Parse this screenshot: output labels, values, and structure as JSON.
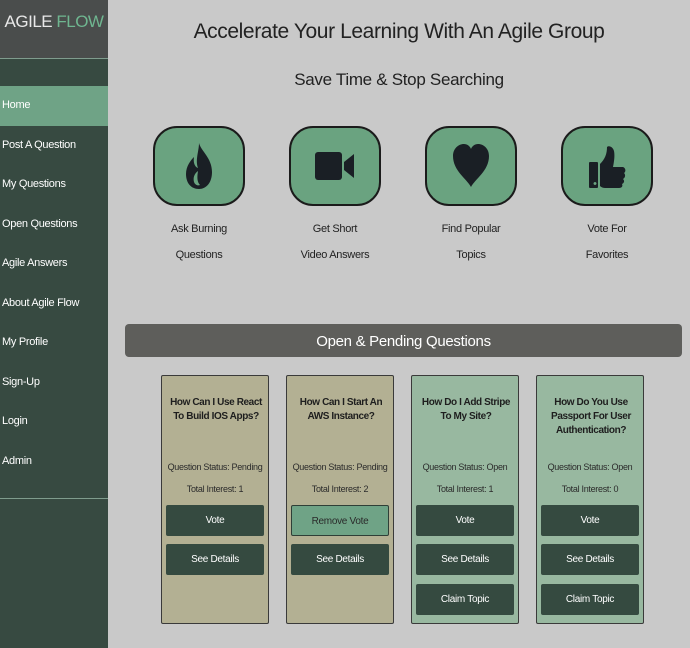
{
  "brand": {
    "part1": "AGILE",
    "part2": "FLOW"
  },
  "nav": {
    "items": [
      "Home",
      "Post A Question",
      "My Questions",
      "Open Questions",
      "Agile Answers",
      "About Agile Flow",
      "My Profile",
      "Sign-Up",
      "Login",
      "Admin"
    ],
    "active": "Home"
  },
  "hero": {
    "headline": "Accelerate Your Learning With An Agile Group",
    "subline": "Save Time & Stop Searching"
  },
  "features": [
    {
      "icon": "fire-icon",
      "line1": "Ask Burning",
      "line2": "Questions"
    },
    {
      "icon": "video-camera-icon",
      "line1": "Get Short",
      "line2": "Video Answers"
    },
    {
      "icon": "heart-icon",
      "line1": "Find Popular",
      "line2": "Topics"
    },
    {
      "icon": "thumbs-up-icon",
      "line1": "Vote For",
      "line2": "Favorites"
    }
  ],
  "section": {
    "title": "Open & Pending Questions"
  },
  "cards": [
    {
      "title": "How Can I Use React To Build IOS Apps?",
      "status": "Question Status: Pending",
      "interest": "Total Interest: 1",
      "vote_label": "Vote",
      "details_label": "See Details"
    },
    {
      "title": "How Can I Start An AWS Instance?",
      "status": "Question Status: Pending",
      "interest": "Total Interest: 2",
      "vote_label": "Remove Vote",
      "details_label": "See Details"
    },
    {
      "title": "How Do I Add Stripe To My Site?",
      "status": "Question Status: Open",
      "interest": "Total Interest: 1",
      "vote_label": "Vote",
      "details_label": "See Details",
      "claim_label": "Claim Topic"
    },
    {
      "title": "How Do You Use Passport For User Authentication?",
      "status": "Question Status: Open",
      "interest": "Total Interest: 0",
      "vote_label": "Vote",
      "details_label": "See Details",
      "claim_label": "Claim Topic"
    }
  ],
  "colors": {
    "sidebar": "#374a41",
    "accent": "#6fa386",
    "pending_card": "#b3b093",
    "open_card": "#98b8a0",
    "section_bar": "#5e5e5b",
    "page_bg": "#c9c9c9"
  }
}
